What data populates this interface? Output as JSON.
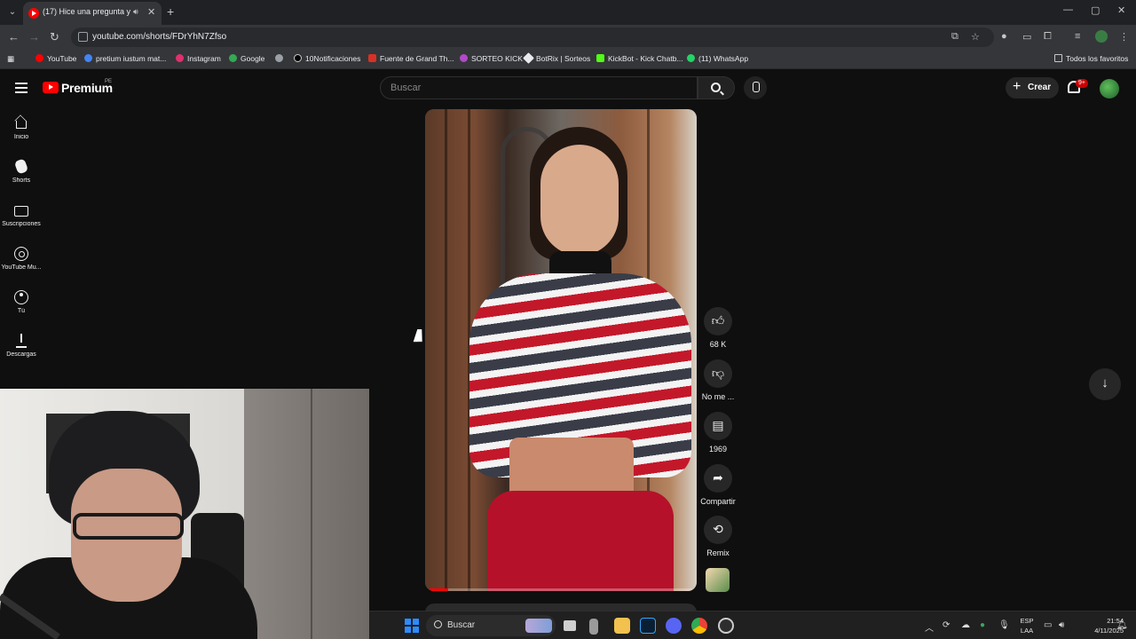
{
  "browser": {
    "tab": {
      "title": "(17) Hice una pregunta y te",
      "audio_icon": "speaker-icon",
      "close": "✕"
    },
    "new_tab": "+",
    "window_controls": [
      "—",
      "▢",
      "✕"
    ],
    "url": "youtube.com/shorts/FDrYhN7Zfso",
    "bookmarks": [
      {
        "label": "YouTube",
        "color": "#ff0000"
      },
      {
        "label": "pretium iustum mat...",
        "color": "#4285f4"
      },
      {
        "label": "Instagram",
        "color": "#e1306c"
      },
      {
        "label": "Google",
        "color": "#34a853"
      },
      {
        "label": "",
        "color": "#9aa0a6"
      },
      {
        "label": "10Notificaciones",
        "color": "#000000"
      },
      {
        "label": "Fuente de Grand Th...",
        "color": "#d93025"
      },
      {
        "label": "SORTEO KICK",
        "color": "#b04ac7"
      },
      {
        "label": "BotRix | Sorteos",
        "color": "#e8eaed"
      },
      {
        "label": "KickBot - Kick Chatb...",
        "color": "#53fc18"
      },
      {
        "label": "(11) WhatsApp",
        "color": "#25d366"
      }
    ],
    "all_favorites": "Todos los favoritos"
  },
  "youtube": {
    "brand": "Premium",
    "region": "PE",
    "search_placeholder": "Buscar",
    "create_label": "Crear",
    "notif_badge": "9+",
    "sidebar": [
      {
        "label": "Inicio",
        "icon": "home-icon"
      },
      {
        "label": "Shorts",
        "icon": "shorts-icon"
      },
      {
        "label": "Suscripciones",
        "icon": "subscriptions-icon"
      },
      {
        "label": "YouTube Mu...",
        "icon": "youtube-music-icon"
      },
      {
        "label": "Tú",
        "icon": "you-icon"
      },
      {
        "label": "Descargas",
        "icon": "downloads-icon"
      }
    ],
    "actions": {
      "like": "68 K",
      "dislike": "No me ...",
      "comments": "1969",
      "share": "Compartir",
      "remix": "Remix"
    },
    "progress": 0.07
  },
  "taskbar": {
    "search": "Buscar",
    "lang_top": "ESP",
    "lang_bottom": "LAA",
    "time": "21:54",
    "date": "4/11/2025"
  }
}
